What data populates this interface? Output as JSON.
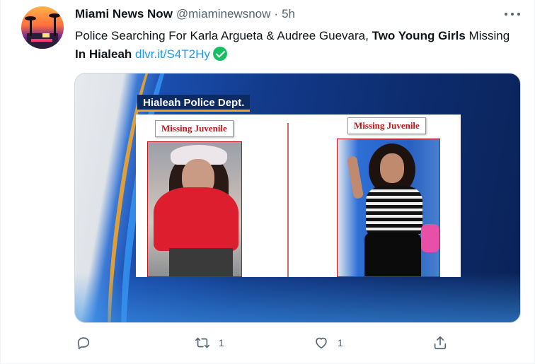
{
  "tweet": {
    "author_name": "Miami News Now",
    "author_handle": "@miaminewsnow",
    "separator": "·",
    "time": "5h",
    "text_parts": {
      "p1": "Police Searching For Karla Argueta & Audree Guevara, ",
      "p2": "Two Young Girls",
      "p3": " Missing ",
      "p4": "In Hialeah",
      "p5": " ",
      "link": "dlvr.it/S4T2Hy"
    },
    "verified_color": "#17bf63",
    "link_color": "#1d9bf0"
  },
  "media": {
    "dept_label": "Hialeah Police Dept.",
    "left_caption": "Missing Juvenile",
    "right_caption": "Missing Juvenile",
    "caption_color": "#c0151b"
  },
  "actions": {
    "reply": {
      "icon": "reply-icon",
      "count": ""
    },
    "retweet": {
      "icon": "retweet-icon",
      "count": "1"
    },
    "like": {
      "icon": "heart-icon",
      "count": "1"
    },
    "share": {
      "icon": "share-icon",
      "count": ""
    }
  }
}
